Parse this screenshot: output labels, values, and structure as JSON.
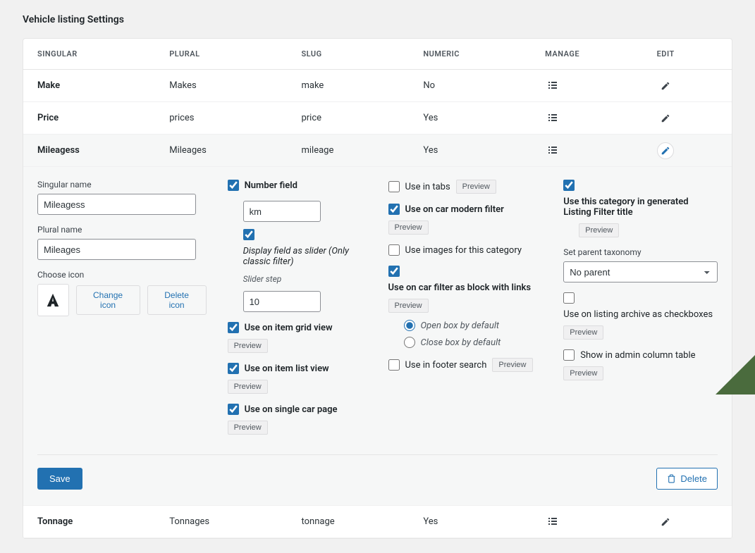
{
  "page_title": "Vehicle listing Settings",
  "columns": {
    "singular": "SINGULAR",
    "plural": "PLURAL",
    "slug": "SLUG",
    "numeric": "NUMERIC",
    "manage": "MANAGE",
    "edit": "EDIT"
  },
  "rows": [
    {
      "singular": "Make",
      "plural": "Makes",
      "slug": "make",
      "numeric": "No"
    },
    {
      "singular": "Price",
      "plural": "prices",
      "slug": "price",
      "numeric": "Yes"
    },
    {
      "singular": "Mileagess",
      "plural": "Mileages",
      "slug": "mileage",
      "numeric": "Yes"
    },
    {
      "singular": "Tonnage",
      "plural": "Tonnages",
      "slug": "tonnage",
      "numeric": "Yes"
    }
  ],
  "form": {
    "singular": {
      "label": "Singular name",
      "value": "Mileagess"
    },
    "plural": {
      "label": "Plural name",
      "value": "Mileages"
    },
    "choose_icon": "Choose icon",
    "change_icon": "Change icon",
    "delete_icon": "Delete icon",
    "number_field": {
      "label": "Number field",
      "unit": "km"
    },
    "display_slider": "Display field as slider (Only classic filter)",
    "slider_step_label": "Slider step",
    "slider_step_value": "10",
    "grid_view": "Use on item grid view",
    "list_view": "Use on item list view",
    "single_page": "Use on single car page",
    "use_tabs": "Use in tabs",
    "modern_filter": "Use on car modern filter",
    "use_images": "Use images for this category",
    "block_links": "Use on car filter as block with links",
    "open_box": "Open box by default",
    "close_box": "Close box by default",
    "footer_search": "Use in footer search",
    "filter_title": "Use this category in generated Listing Filter title",
    "parent_taxonomy_label": "Set parent taxonomy",
    "parent_taxonomy_value": "No parent",
    "archive_checkboxes": "Use on listing archive as checkboxes",
    "admin_column": "Show in admin column table",
    "preview": "Preview",
    "save": "Save",
    "delete": "Delete"
  }
}
